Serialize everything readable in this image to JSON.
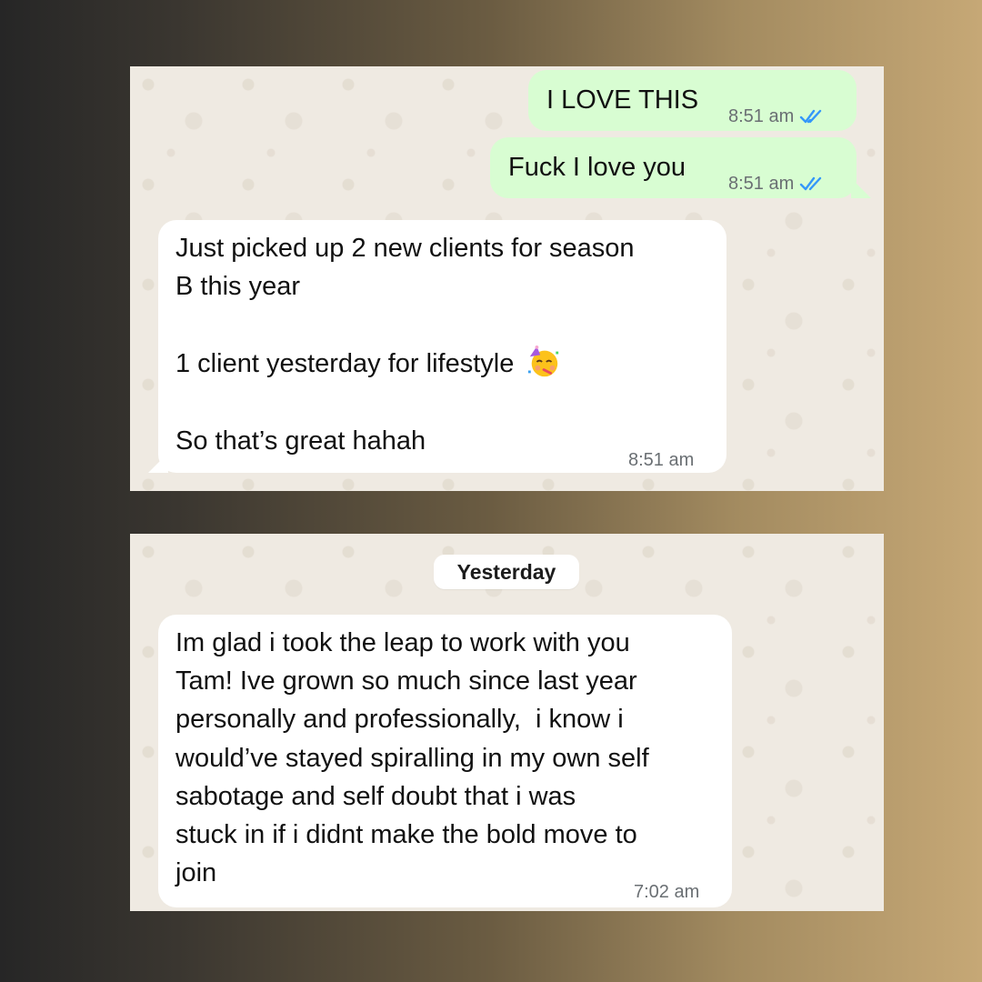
{
  "top_chat": {
    "messages": [
      {
        "direction": "outgoing",
        "text": "I LOVE THIS",
        "time": "8:51 am",
        "status": "read"
      },
      {
        "direction": "outgoing",
        "text": "Fuck I love you",
        "time": "8:51 am",
        "status": "read"
      },
      {
        "direction": "incoming",
        "line1": "Just picked up 2 new clients for season",
        "line2": "B this year",
        "line3": "1 client yesterday for lifestyle",
        "emoji": "partying-face",
        "line4": "So that’s great hahah",
        "time": "8:51 am"
      }
    ]
  },
  "bottom_chat": {
    "date_label": "Yesterday",
    "messages": [
      {
        "direction": "incoming",
        "lines": [
          "Im glad i took the leap to work with you",
          "Tam! Ive grown so much since last year",
          "personally and professionally,  i know i",
          "would’ve stayed spiralling in my own self",
          "sabotage and self doubt that i was",
          "stuck in if i didnt make the bold move to",
          "join"
        ],
        "time": "7:02 am"
      }
    ]
  },
  "colors": {
    "outgoing_bubble": "#d8fdd2",
    "incoming_bubble": "#ffffff",
    "chat_background": "#efeae2",
    "read_tick": "#3497f9"
  },
  "icons": {
    "read_receipt": "double-check-icon"
  }
}
